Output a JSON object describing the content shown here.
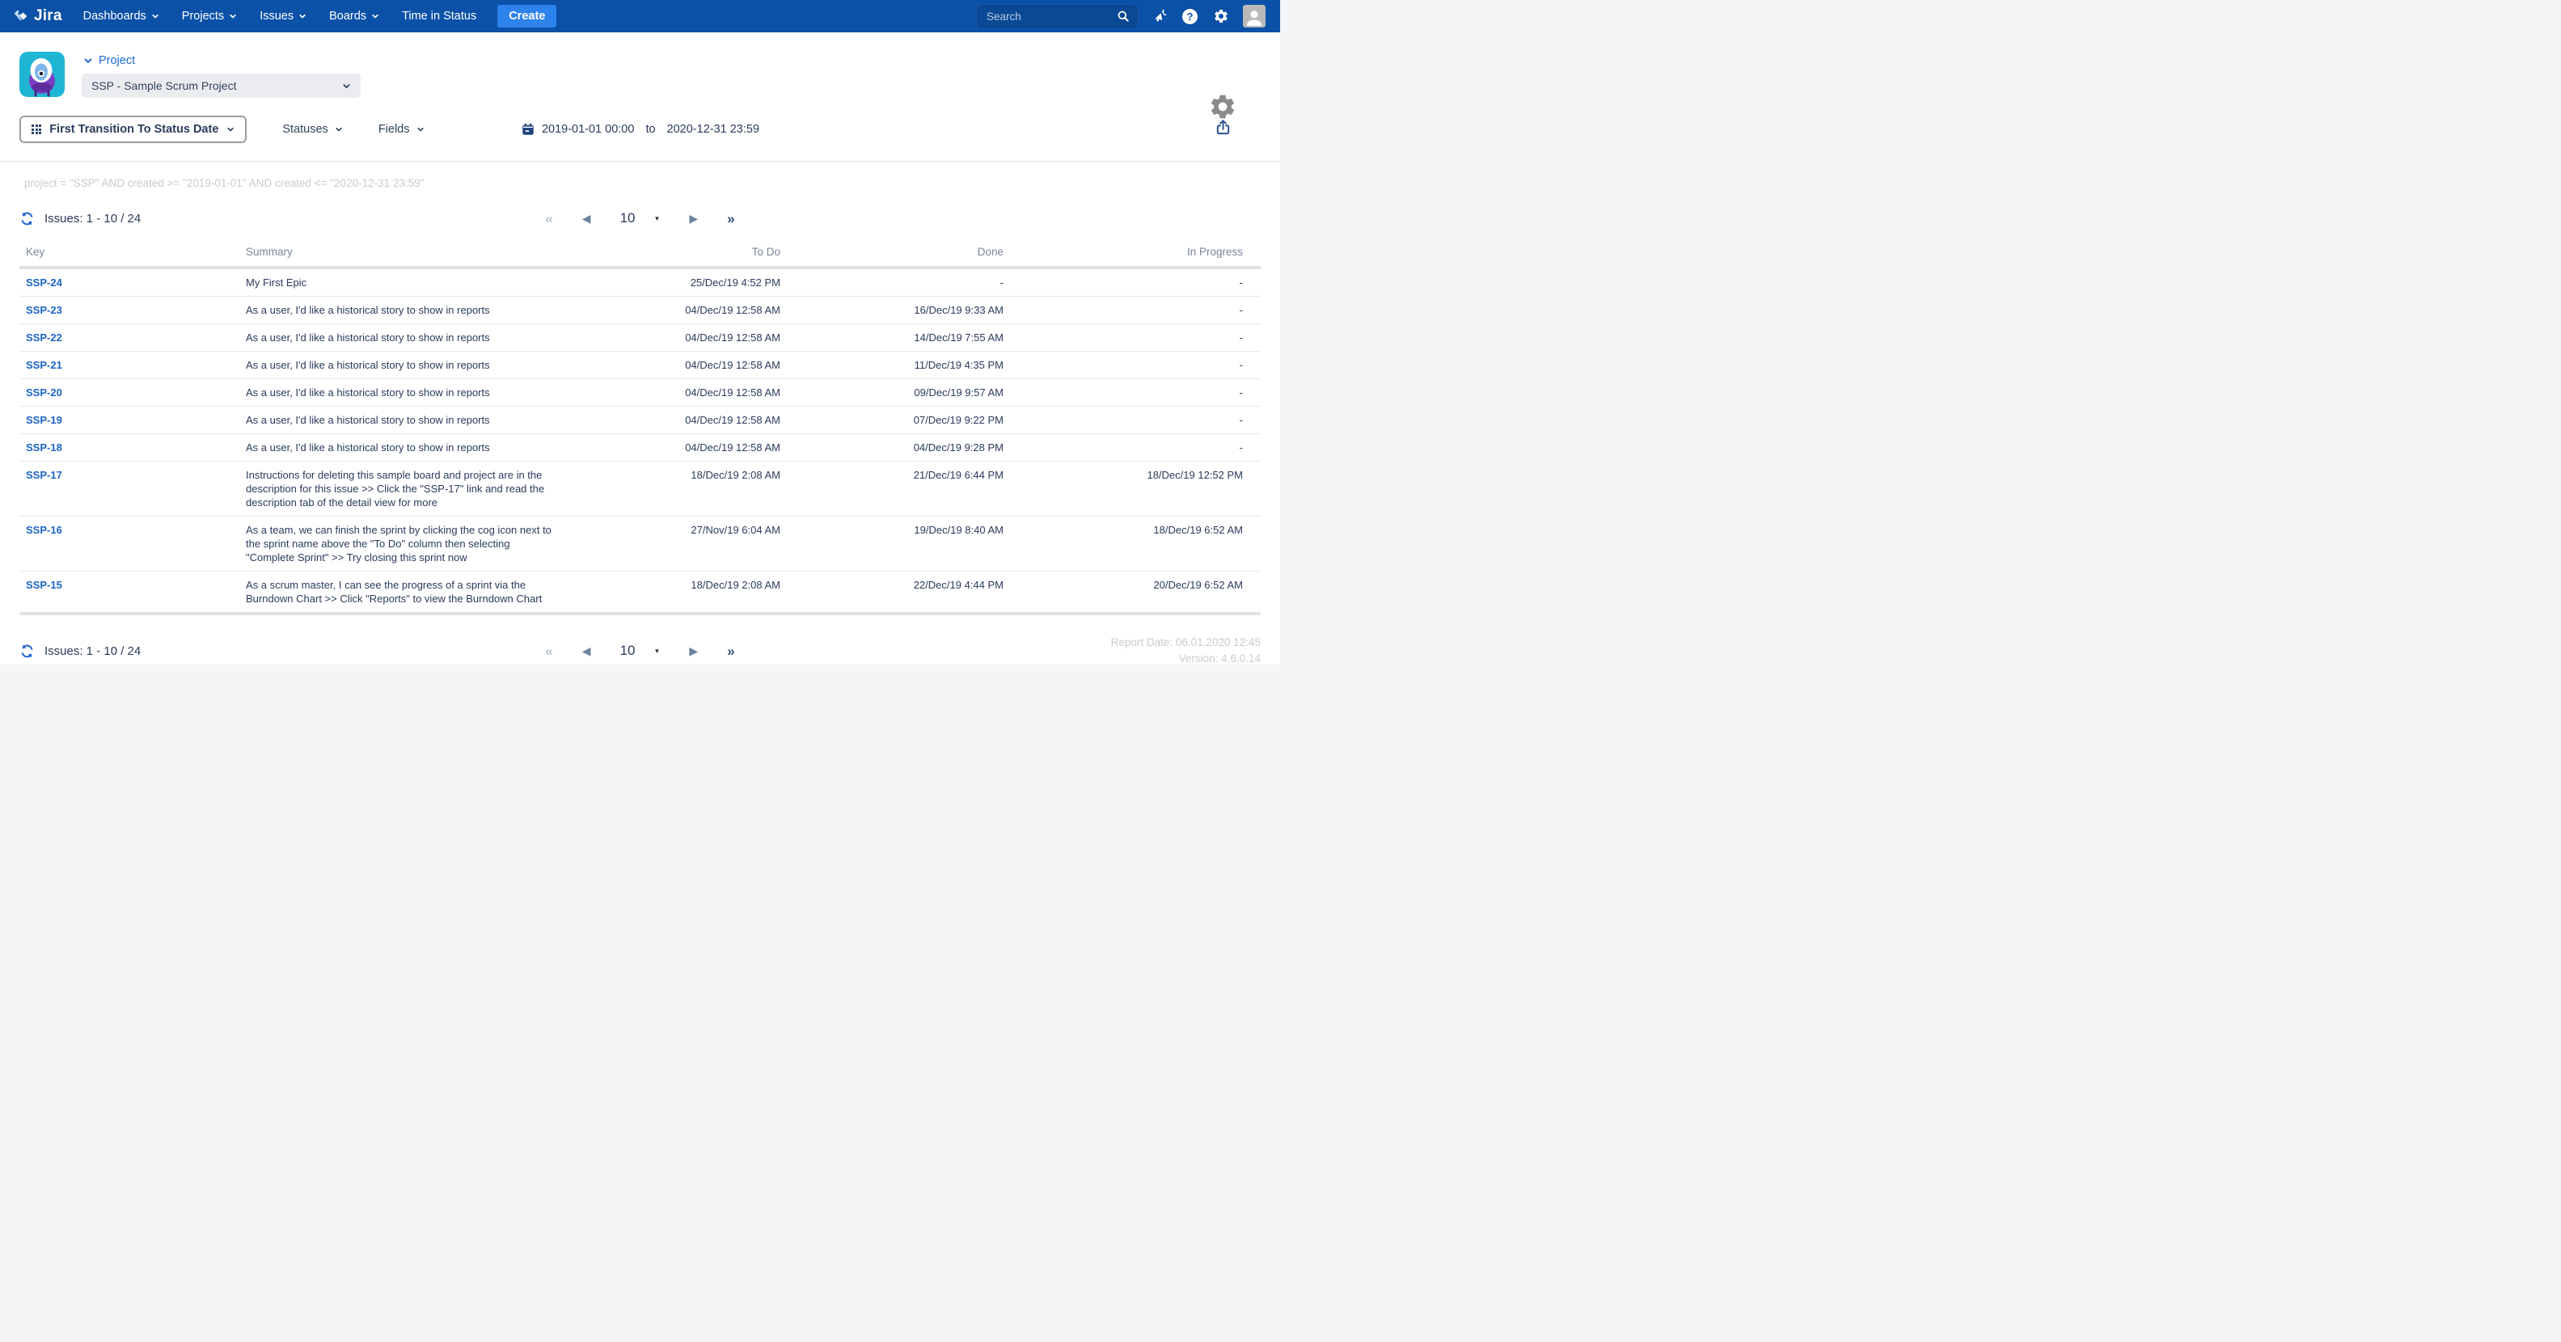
{
  "nav": {
    "brand": "Jira",
    "items": [
      {
        "label": "Dashboards"
      },
      {
        "label": "Projects"
      },
      {
        "label": "Issues"
      },
      {
        "label": "Boards"
      },
      {
        "label": "Time in Status"
      }
    ],
    "create_label": "Create",
    "search_placeholder": "Search"
  },
  "header": {
    "project_label": "Project",
    "project_select_value": "SSP - Sample Scrum Project"
  },
  "filters": {
    "report_type": "First Transition To Status Date",
    "statuses_label": "Statuses",
    "fields_label": "Fields",
    "date_from": "2019-01-01 00:00",
    "date_to_word": "to",
    "date_to": "2020-12-31 23:59"
  },
  "jql": "project = \"SSP\" AND created >= \"2019-01-01\" AND created <= \"2020-12-31 23:59\"",
  "issues_count": "Issues: 1 - 10 / 24",
  "pagination": {
    "first": "«",
    "prev": "◀",
    "page_size": "10",
    "caret": "▼",
    "next": "▶",
    "last": "»"
  },
  "table": {
    "columns": [
      "Key",
      "Summary",
      "To Do",
      "Done",
      "In Progress"
    ],
    "rows": [
      {
        "key": "SSP-24",
        "summary": "My First Epic",
        "todo": "25/Dec/19 4:52 PM",
        "done": "-",
        "in_progress": "-"
      },
      {
        "key": "SSP-23",
        "summary": "As a user, I'd like a historical story to show in reports",
        "todo": "04/Dec/19 12:58 AM",
        "done": "16/Dec/19 9:33 AM",
        "in_progress": "-"
      },
      {
        "key": "SSP-22",
        "summary": "As a user, I'd like a historical story to show in reports",
        "todo": "04/Dec/19 12:58 AM",
        "done": "14/Dec/19 7:55 AM",
        "in_progress": "-"
      },
      {
        "key": "SSP-21",
        "summary": "As a user, I'd like a historical story to show in reports",
        "todo": "04/Dec/19 12:58 AM",
        "done": "11/Dec/19 4:35 PM",
        "in_progress": "-"
      },
      {
        "key": "SSP-20",
        "summary": "As a user, I'd like a historical story to show in reports",
        "todo": "04/Dec/19 12:58 AM",
        "done": "09/Dec/19 9:57 AM",
        "in_progress": "-"
      },
      {
        "key": "SSP-19",
        "summary": "As a user, I'd like a historical story to show in reports",
        "todo": "04/Dec/19 12:58 AM",
        "done": "07/Dec/19 9:22 PM",
        "in_progress": "-"
      },
      {
        "key": "SSP-18",
        "summary": "As a user, I'd like a historical story to show in reports",
        "todo": "04/Dec/19 12:58 AM",
        "done": "04/Dec/19 9:28 PM",
        "in_progress": "-"
      },
      {
        "key": "SSP-17",
        "summary": "Instructions for deleting this sample board and project are in the description for this issue >> Click the \"SSP-17\" link and read the description tab of the detail view for more",
        "todo": "18/Dec/19 2:08 AM",
        "done": "21/Dec/19 6:44 PM",
        "in_progress": "18/Dec/19 12:52 PM"
      },
      {
        "key": "SSP-16",
        "summary": "As a team, we can finish the sprint by clicking the cog icon next to the sprint name above the \"To Do\" column then selecting \"Complete Sprint\" >> Try closing this sprint now",
        "todo": "27/Nov/19 6:04 AM",
        "done": "19/Dec/19 8:40 AM",
        "in_progress": "18/Dec/19 6:52 AM"
      },
      {
        "key": "SSP-15",
        "summary": "As a scrum master, I can see the progress of a sprint via the Burndown Chart >> Click \"Reports\" to view the Burndown Chart",
        "todo": "18/Dec/19 2:08 AM",
        "done": "22/Dec/19 4:44 PM",
        "in_progress": "20/Dec/19 6:52 AM"
      }
    ]
  },
  "footer": {
    "report_date": "Report Date: 06.01.2020 12:45",
    "version": "Version: 4.6.0.14"
  },
  "colors": {
    "nav_bg": "#0b51a8",
    "create_button": "#2e82ec",
    "link_blue": "#1b64c8",
    "text_navy": "#2b3a5c",
    "header_gray": "#7a869a",
    "muted_gray": "#c7ccd1",
    "project_avatar_teal": "#1fb6d4",
    "project_avatar_purple": "#7b3fc4"
  }
}
